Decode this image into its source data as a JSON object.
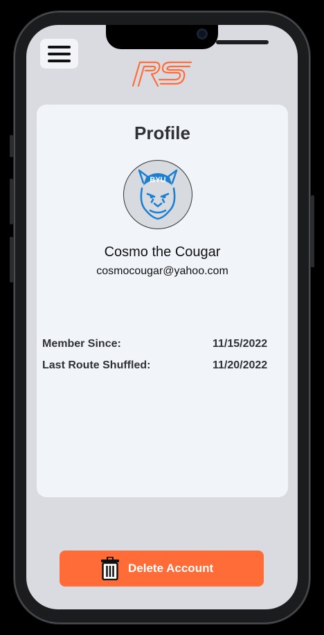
{
  "header": {
    "menu_icon": "hamburger-menu-icon",
    "logo_text": "RS"
  },
  "profile": {
    "title": "Profile",
    "avatar_icon": "byu-cougar-mascot",
    "name": "Cosmo the Cougar",
    "email": "cosmocougar@yahoo.com",
    "details": [
      {
        "label": "Member Since:",
        "value": "11/15/2022"
      },
      {
        "label": "Last Route Shuffled:",
        "value": "11/20/2022"
      }
    ]
  },
  "actions": {
    "delete_label": "Delete Account",
    "delete_icon": "trash-icon"
  },
  "colors": {
    "accent": "#ff6c37",
    "screen_bg": "#d9dbe0",
    "card_bg": "#f1f4f8",
    "text_dark": "#2f3136",
    "avatar_blue": "#1d7fd0"
  }
}
